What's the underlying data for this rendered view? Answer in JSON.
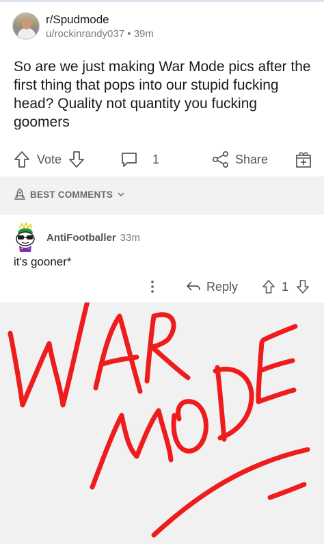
{
  "post": {
    "subreddit": "r/Spudmode",
    "author": "u/rockinrandy037",
    "separator": "•",
    "age": "39m",
    "title": "So are we just making War Mode pics after the first thing that pops into our stupid fucking head? Quality not quantity you fucking goomers"
  },
  "actions": {
    "vote_label": "Vote",
    "comment_count": "1",
    "share_label": "Share"
  },
  "sort": {
    "label": "BEST COMMENTS"
  },
  "comment": {
    "author": "AntiFootballer",
    "age": "33m",
    "body": "it's gooner*",
    "reply_label": "Reply",
    "score": "1"
  },
  "drawing": {
    "stroke_color": "#ee1c1c",
    "background": "#f1f1f1"
  },
  "colors": {
    "text_primary": "#1a1a1b",
    "text_secondary": "#7c7c7c",
    "icon": "#555555",
    "band": "#f2f2f2"
  },
  "icons": {
    "upvote": "arrow-up-outline-icon",
    "downvote": "arrow-down-outline-icon",
    "comment": "speech-bubble-icon",
    "share": "share-nodes-icon",
    "award": "gift-box-icon",
    "sort": "rocket-icon",
    "overflow": "vertical-dots-icon",
    "reply": "reply-arrow-icon"
  }
}
